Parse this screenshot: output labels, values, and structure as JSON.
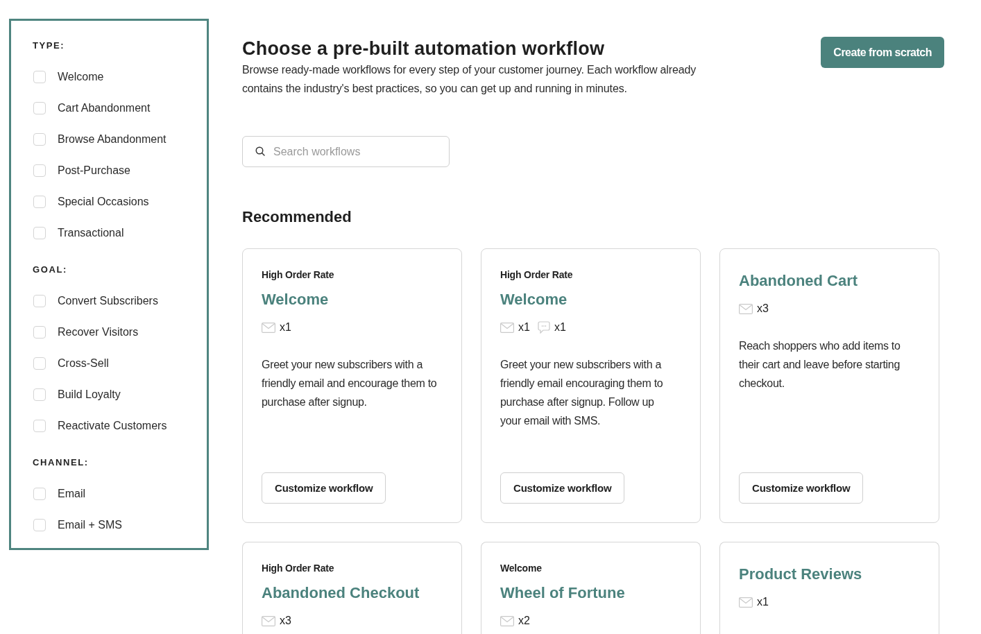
{
  "sidebar": {
    "sections": [
      {
        "heading": "TYPE:",
        "options": [
          {
            "label": "Welcome",
            "checked": false
          },
          {
            "label": "Cart Abandonment",
            "checked": false
          },
          {
            "label": "Browse Abandonment",
            "checked": false
          },
          {
            "label": "Post-Purchase",
            "checked": false
          },
          {
            "label": "Special Occasions",
            "checked": false
          },
          {
            "label": "Transactional",
            "checked": false
          }
        ]
      },
      {
        "heading": "GOAL:",
        "options": [
          {
            "label": "Convert Subscribers",
            "checked": false
          },
          {
            "label": "Recover Visitors",
            "checked": false
          },
          {
            "label": "Cross-Sell",
            "checked": false
          },
          {
            "label": "Build Loyalty",
            "checked": false
          },
          {
            "label": "Reactivate Customers",
            "checked": false
          }
        ]
      },
      {
        "heading": "CHANNEL:",
        "options": [
          {
            "label": "Email",
            "checked": false
          },
          {
            "label": "Email + SMS",
            "checked": false
          }
        ]
      }
    ]
  },
  "header": {
    "title": "Choose a pre-built automation workflow",
    "description": "Browse ready-made workflows for every step of your customer journey. Each workflow already contains the industry's best practices, so you can get up and running in minutes.",
    "create_button": "Create from scratch"
  },
  "search": {
    "placeholder": "Search workflows"
  },
  "recommended": {
    "heading": "Recommended",
    "cards": [
      {
        "tag": "High Order Rate",
        "title": "Welcome",
        "channels": [
          {
            "kind": "email",
            "count": "x1"
          }
        ],
        "description": "Greet your new subscribers with a friendly email and encourage them to purchase after signup.",
        "button": "Customize workflow"
      },
      {
        "tag": "High Order Rate",
        "title": "Welcome",
        "channels": [
          {
            "kind": "email",
            "count": "x1"
          },
          {
            "kind": "sms",
            "count": "x1"
          }
        ],
        "description": "Greet your new subscribers with a friendly email encouraging them to purchase after signup. Follow up your email with SMS.",
        "button": "Customize workflow"
      },
      {
        "title": "Abandoned Cart",
        "channels": [
          {
            "kind": "email",
            "count": "x3"
          }
        ],
        "description": "Reach shoppers who add items to their cart and leave before starting checkout.",
        "button": "Customize workflow"
      },
      {
        "tag": "High Order Rate",
        "title": "Abandoned Checkout",
        "channels": [
          {
            "kind": "email",
            "count": "x3"
          }
        ]
      },
      {
        "tag": "Welcome",
        "title": "Wheel of Fortune",
        "channels": [
          {
            "kind": "email",
            "count": "x2"
          }
        ]
      },
      {
        "title": "Product Reviews",
        "channels": [
          {
            "kind": "email",
            "count": "x1"
          }
        ]
      }
    ]
  }
}
